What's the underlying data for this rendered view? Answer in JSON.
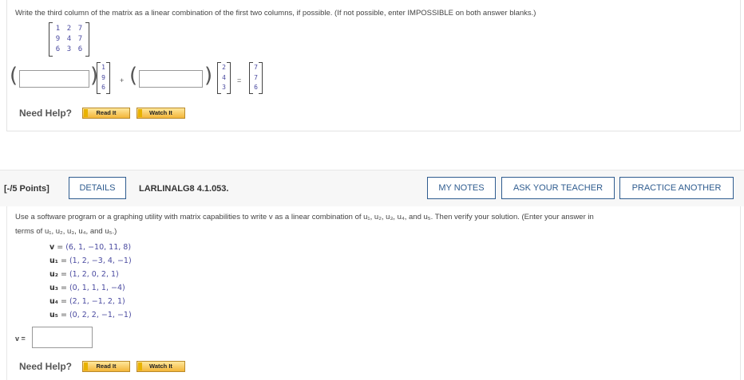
{
  "question1": {
    "instruction": "Write the third column of the matrix as a linear combination of the first two columns, if possible. (If not possible, enter IMPOSSIBLE on both answer blanks.)",
    "matrix": [
      [
        "1",
        "2",
        "7"
      ],
      [
        "9",
        "4",
        "7"
      ],
      [
        "6",
        "3",
        "6"
      ]
    ],
    "col1": [
      "1",
      "9",
      "6"
    ],
    "col2": [
      "2",
      "4",
      "3"
    ],
    "col3": [
      "7",
      "7",
      "6"
    ],
    "plus": "+",
    "equals": "=",
    "answer1": "",
    "answer2": ""
  },
  "help": {
    "label": "Need Help?",
    "read_it": "Read It",
    "watch_it": "Watch It"
  },
  "question2": {
    "points": "[-/5 Points]",
    "details": "DETAILS",
    "code": "LARLINALG8 4.1.053.",
    "my_notes": "MY NOTES",
    "ask_teacher": "ASK YOUR TEACHER",
    "practice_another": "PRACTICE ANOTHER",
    "text_line1": "Use a software program or a graphing utility with matrix capabilities to write v as a linear combination of u₁, u₂, u₃, u₄, and u₅. Then verify your solution. (Enter your answer in",
    "text_line2": "terms of u₁, u₂, u₃, u₄, and u₅.)",
    "vectors": [
      {
        "name": "v",
        "value": "(6, 1, −10, 11, 8)"
      },
      {
        "name": "u₁",
        "value": "(1, 2, −3, 4, −1)"
      },
      {
        "name": "u₂",
        "value": "(1, 2, 0, 2, 1)"
      },
      {
        "name": "u₃",
        "value": "(0, 1, 1, 1, −4)"
      },
      {
        "name": "u₄",
        "value": "(2, 1, −1, 2, 1)"
      },
      {
        "name": "u₅",
        "value": "(0, 2, 2, −1, −1)"
      }
    ],
    "v_label": "v =",
    "v_answer": ""
  }
}
